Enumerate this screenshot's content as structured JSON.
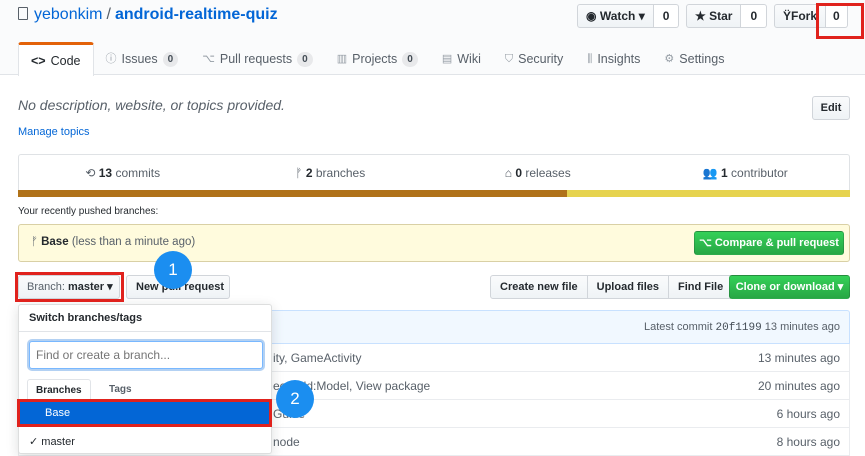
{
  "repo": {
    "owner": "yebonkim",
    "separator": "/",
    "name": "android-realtime-quiz"
  },
  "social": [
    {
      "label": "Watch ▾",
      "count": "0",
      "icon": "eye-icon"
    },
    {
      "label": "Star",
      "count": "0",
      "icon": "star-icon"
    },
    {
      "label": "Fork",
      "count": "0",
      "icon": "fork-icon"
    }
  ],
  "tabs": [
    {
      "label": "Code",
      "icon": "code-icon",
      "selected": true
    },
    {
      "label": "Issues",
      "count": "0",
      "icon": "issue-icon"
    },
    {
      "label": "Pull requests",
      "count": "0",
      "icon": "pr-icon"
    },
    {
      "label": "Projects",
      "count": "0",
      "icon": "project-icon"
    },
    {
      "label": "Wiki",
      "icon": "book-icon"
    },
    {
      "label": "Security",
      "icon": "shield-icon"
    },
    {
      "label": "Insights",
      "icon": "graph-icon"
    },
    {
      "label": "Settings",
      "icon": "gear-icon"
    }
  ],
  "description": "No description, website, or topics provided.",
  "manage_topics": "Manage topics",
  "edit_label": "Edit",
  "summary": {
    "commits_num": "13",
    "commits_label": "commits",
    "branches_num": "2",
    "branches_label": "branches",
    "releases_num": "0",
    "releases_label": "releases",
    "contributors_num": "1",
    "contributors_label": "contributor"
  },
  "language_colors": [
    "#b07219",
    "#e6d34f"
  ],
  "language_shares": [
    0.66,
    0.34
  ],
  "recent_label": "Your recently pushed branches:",
  "pushed": {
    "branch": "Base",
    "time": "(less than a minute ago)",
    "compare_label": "Compare & pull request"
  },
  "branch_button": {
    "prefix": "Branch:",
    "value": "master ▾"
  },
  "new_pr_label": "New pull request",
  "file_buttons": [
    "Create new file",
    "Upload files",
    "Find File"
  ],
  "clone_label": "Clone or download ▾",
  "latest_commit": {
    "label": "Latest commit",
    "sha": "20f1199",
    "time": "13 minutes ago"
  },
  "files": [
    {
      "message": "ity, GameActivity",
      "age": "13 minutes ago"
    },
    {
      "message": "ect Add:Model, View package",
      "age": "20 minutes ago"
    },
    {
      "message": "Guide",
      "age": "6 hours ago"
    },
    {
      "message": "node",
      "age": "8 hours ago"
    }
  ],
  "dropdown": {
    "title": "Switch branches/tags",
    "placeholder": "Find or create a branch...",
    "tab_branches": "Branches",
    "tab_tags": "Tags",
    "items": [
      "Base",
      "master"
    ]
  },
  "annotations": [
    "1",
    "2"
  ],
  "accent": {
    "red": "#e0221d",
    "blue": "#1b8ef0",
    "green": "#28a745"
  }
}
